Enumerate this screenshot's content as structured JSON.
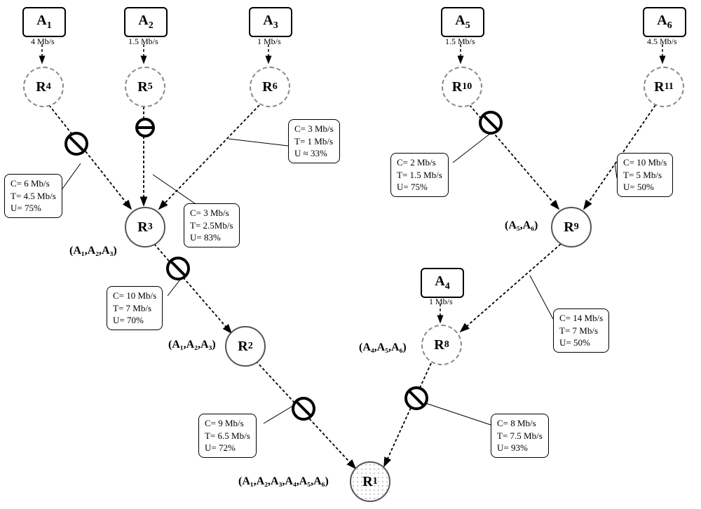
{
  "sources": {
    "A1": {
      "label": "A",
      "sub": "1",
      "rate": "4 Mb/s"
    },
    "A2": {
      "label": "A",
      "sub": "2",
      "rate": "1.5 Mb/s"
    },
    "A3": {
      "label": "A",
      "sub": "3",
      "rate": "1 Mb/s"
    },
    "A4": {
      "label": "A",
      "sub": "4",
      "rate": "1 Mb/s"
    },
    "A5": {
      "label": "A",
      "sub": "5",
      "rate": "1.5 Mb/s"
    },
    "A6": {
      "label": "A",
      "sub": "6",
      "rate": "4.5 Mb/s"
    }
  },
  "routers": {
    "R1": {
      "label": "R",
      "sub": "1"
    },
    "R2": {
      "label": "R",
      "sub": "2"
    },
    "R3": {
      "label": "R",
      "sub": "3"
    },
    "R4": {
      "label": "R",
      "sub": "4"
    },
    "R5": {
      "label": "R",
      "sub": "5"
    },
    "R6": {
      "label": "R",
      "sub": "6"
    },
    "R8": {
      "label": "R",
      "sub": "8"
    },
    "R9": {
      "label": "R",
      "sub": "9"
    },
    "R10": {
      "label": "R",
      "sub": "10"
    },
    "R11": {
      "label": "R",
      "sub": "11"
    }
  },
  "links": {
    "R4_R3": {
      "C": "C= 6 Mb/s",
      "T": "T= 4.5 Mb/s",
      "U": "U= 75%"
    },
    "R5_R3": {
      "C": "C= 3 Mb/s",
      "T": "T= 2.5Mb/s",
      "U": "U= 83%"
    },
    "R6_R3": {
      "C": "C= 3 Mb/s",
      "T": "T= 1 Mb/s",
      "U": "U ≈ 33%"
    },
    "R3_R2": {
      "C": "C= 10 Mb/s",
      "T": "T= 7 Mb/s",
      "U": "U= 70%"
    },
    "R2_R1": {
      "C": "C= 9 Mb/s",
      "T": "T= 6.5 Mb/s",
      "U": "U= 72%"
    },
    "R10_R9": {
      "C": "C= 2 Mb/s",
      "T": "T= 1.5 Mb/s",
      "U": "U= 75%"
    },
    "R11_R9": {
      "C": "C= 10 Mb/s",
      "T": "T= 5 Mb/s",
      "U": "U= 50%"
    },
    "R9_R8": {
      "C": "C= 14 Mb/s",
      "T": "T= 7 Mb/s",
      "U": "U= 50%"
    },
    "R8_R1": {
      "C": "C= 8 Mb/s",
      "T": "T= 7.5 Mb/s",
      "U": "U= 93%"
    }
  },
  "annotations": {
    "R3": "(A₁,A₂,A₃)",
    "R2": "(A₁,A₂,A₃)",
    "R9": "(A₅,A₆)",
    "R8": "(A₄,A₅,A₆)",
    "R1": "(A₁,A₂,A₃,A₄,A₅,A₆)"
  },
  "chart_data": {
    "type": "diagram",
    "description": "Network routing tree with sources A1–A6, routers R1–R11, link capacities/throughputs/utilizations, and congestion markers on some links.",
    "nodes": {
      "sources": [
        "A1",
        "A2",
        "A3",
        "A4",
        "A5",
        "A6"
      ],
      "edge_routers": [
        "R4",
        "R5",
        "R6",
        "R10",
        "R11",
        "R8"
      ],
      "core_routers": [
        "R3",
        "R2",
        "R9",
        "R1"
      ]
    },
    "source_rates_Mbps": {
      "A1": 4,
      "A2": 1.5,
      "A3": 1,
      "A4": 1,
      "A5": 1.5,
      "A6": 4.5
    },
    "source_to_edge": {
      "A1": "R4",
      "A2": "R5",
      "A3": "R6",
      "A4": "R8",
      "A5": "R10",
      "A6": "R11"
    },
    "links": [
      {
        "from": "R4",
        "to": "R3",
        "C_Mbps": 6,
        "T_Mbps": 4.5,
        "U_pct": 75,
        "congested": true
      },
      {
        "from": "R5",
        "to": "R3",
        "C_Mbps": 3,
        "T_Mbps": 2.5,
        "U_pct": 83,
        "congested": true
      },
      {
        "from": "R6",
        "to": "R3",
        "C_Mbps": 3,
        "T_Mbps": 1,
        "U_pct": 33,
        "congested": false
      },
      {
        "from": "R3",
        "to": "R2",
        "C_Mbps": 10,
        "T_Mbps": 7,
        "U_pct": 70,
        "congested": true
      },
      {
        "from": "R2",
        "to": "R1",
        "C_Mbps": 9,
        "T_Mbps": 6.5,
        "U_pct": 72,
        "congested": true
      },
      {
        "from": "R10",
        "to": "R9",
        "C_Mbps": 2,
        "T_Mbps": 1.5,
        "U_pct": 75,
        "congested": true
      },
      {
        "from": "R11",
        "to": "R9",
        "C_Mbps": 10,
        "T_Mbps": 5,
        "U_pct": 50,
        "congested": false
      },
      {
        "from": "R9",
        "to": "R8",
        "C_Mbps": 14,
        "T_Mbps": 7,
        "U_pct": 50,
        "congested": false
      },
      {
        "from": "R8",
        "to": "R1",
        "C_Mbps": 8,
        "T_Mbps": 7.5,
        "U_pct": 93,
        "congested": true
      }
    ],
    "aggregated_flows": {
      "R3": [
        "A1",
        "A2",
        "A3"
      ],
      "R2": [
        "A1",
        "A2",
        "A3"
      ],
      "R9": [
        "A5",
        "A6"
      ],
      "R8": [
        "A4",
        "A5",
        "A6"
      ],
      "R1": [
        "A1",
        "A2",
        "A3",
        "A4",
        "A5",
        "A6"
      ]
    }
  }
}
